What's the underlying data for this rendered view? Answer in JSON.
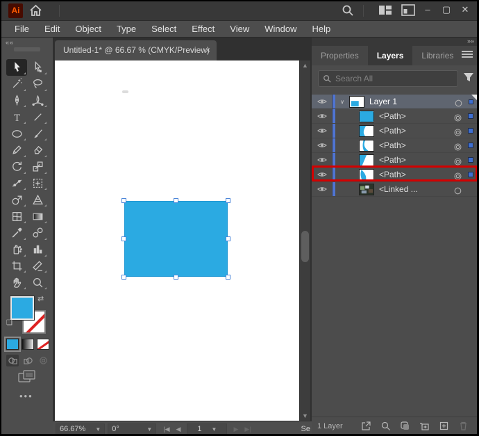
{
  "window": {
    "logo_text": "Ai",
    "controls": {
      "minimize": "–",
      "maximize": "▢",
      "close": "✕"
    }
  },
  "menu_bar": {
    "items": [
      "File",
      "Edit",
      "Object",
      "Type",
      "Select",
      "Effect",
      "View",
      "Window",
      "Help"
    ]
  },
  "document_tab": {
    "title": "Untitled-1* @ 66.67 % (CMYK/Preview)",
    "close_label": "×"
  },
  "toolbar": {
    "collapse_label": "««",
    "ellipsis_label": "•••",
    "tools": [
      {
        "name": "selection-tool",
        "icon": "selection",
        "active": true
      },
      {
        "name": "direct-selection-tool",
        "icon": "direct"
      },
      {
        "name": "magic-wand-tool",
        "icon": "wand"
      },
      {
        "name": "lasso-tool",
        "icon": "lasso"
      },
      {
        "name": "pen-tool",
        "icon": "pen"
      },
      {
        "name": "curvature-tool",
        "icon": "curvature"
      },
      {
        "name": "type-tool",
        "icon": "type"
      },
      {
        "name": "line-segment-tool",
        "icon": "line"
      },
      {
        "name": "ellipse-tool",
        "icon": "ellipse"
      },
      {
        "name": "paintbrush-tool",
        "icon": "brush"
      },
      {
        "name": "pencil-tool",
        "icon": "pencil"
      },
      {
        "name": "eraser-tool",
        "icon": "eraser"
      },
      {
        "name": "rotate-tool",
        "icon": "rotate"
      },
      {
        "name": "scale-tool",
        "icon": "scale"
      },
      {
        "name": "width-tool",
        "icon": "width"
      },
      {
        "name": "free-transform-tool",
        "icon": "freetransform"
      },
      {
        "name": "shape-builder-tool",
        "icon": "shapebuilder"
      },
      {
        "name": "perspective-grid-tool",
        "icon": "perspective"
      },
      {
        "name": "mesh-tool",
        "icon": "mesh"
      },
      {
        "name": "gradient-tool",
        "icon": "gradient"
      },
      {
        "name": "eyedropper-tool",
        "icon": "eyedropper"
      },
      {
        "name": "blend-tool",
        "icon": "blend"
      },
      {
        "name": "symbol-sprayer-tool",
        "icon": "sprayer"
      },
      {
        "name": "column-graph-tool",
        "icon": "graph"
      },
      {
        "name": "artboard-tool",
        "icon": "artboard"
      },
      {
        "name": "slice-tool",
        "icon": "slice"
      },
      {
        "name": "hand-tool",
        "icon": "hand"
      },
      {
        "name": "zoom-tool",
        "icon": "zoom"
      }
    ]
  },
  "canvas": {
    "shape": {
      "fill": "#2BAAE2"
    }
  },
  "right_panel": {
    "collapse_label": "»»",
    "tabs": [
      {
        "label": "Properties",
        "active": false
      },
      {
        "label": "Layers",
        "active": true
      },
      {
        "label": "Libraries",
        "active": false
      }
    ],
    "search": {
      "placeholder": "Search All"
    }
  },
  "layers": {
    "rows": [
      {
        "name": "Layer 1",
        "thumb": "layer1",
        "indent": false,
        "selected": true,
        "chevron": "∨",
        "target": "single",
        "proxy": "small"
      },
      {
        "name": "<Path>",
        "thumb": "path-solid",
        "indent": true,
        "selected": false,
        "chevron": "",
        "target": "double",
        "proxy": "normal",
        "annotated": true
      },
      {
        "name": "<Path>",
        "thumb": "wedge-a",
        "indent": true,
        "selected": false,
        "chevron": "",
        "target": "double",
        "proxy": "normal"
      },
      {
        "name": "<Path>",
        "thumb": "curve-b",
        "indent": true,
        "selected": false,
        "chevron": "",
        "target": "double",
        "proxy": "normal"
      },
      {
        "name": "<Path>",
        "thumb": "wedge-c",
        "indent": true,
        "selected": false,
        "chevron": "",
        "target": "double",
        "proxy": "normal"
      },
      {
        "name": "<Path>",
        "thumb": "curve-d",
        "indent": true,
        "selected": false,
        "chevron": "",
        "target": "double",
        "proxy": "normal"
      },
      {
        "name": "<Linked ...",
        "thumb": "photo",
        "indent": true,
        "selected": false,
        "chevron": "",
        "target": "single",
        "proxy": "none"
      }
    ],
    "footer": {
      "count_label": "1 Layer"
    }
  },
  "status_bar": {
    "zoom_level": "66.67%",
    "rotation": "0°",
    "artboard_number": "1",
    "truncated_label": "Se"
  },
  "colors": {
    "accent_blue": "#2BAAE2",
    "layer_color_bar": "#4f74d2",
    "annotation_red": "#d40000",
    "selection_handle_border": "#4a84d8"
  }
}
